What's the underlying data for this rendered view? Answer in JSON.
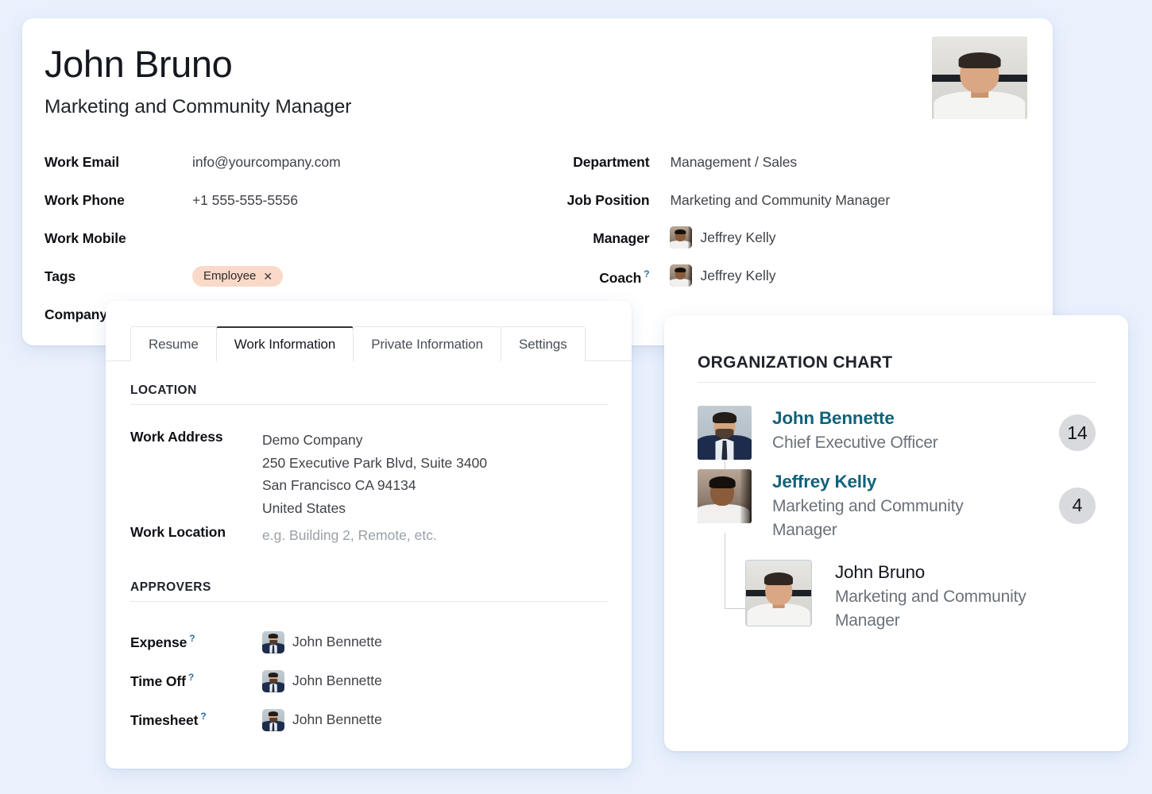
{
  "profile": {
    "name": "John Bruno",
    "job_title": "Marketing and Community Manager",
    "photo_alt": "employee-photo",
    "left_fields": [
      {
        "label": "Work Email",
        "value": "info@yourcompany.com"
      },
      {
        "label": "Work Phone",
        "value": "+1 555-555-5556"
      },
      {
        "label": "Work Mobile",
        "value": ""
      },
      {
        "label": "Tags",
        "value": ""
      },
      {
        "label": "Company",
        "value": ""
      }
    ],
    "tag": {
      "label": "Employee",
      "remove": "✕",
      "bg": "#fad9c8"
    },
    "right_fields": [
      {
        "label": "Department",
        "value": "Management / Sales"
      },
      {
        "label": "Job Position",
        "value": "Marketing and Community Manager"
      }
    ],
    "manager": {
      "label": "Manager",
      "name": "Jeffrey Kelly"
    },
    "coach": {
      "label": "Coach",
      "help": "?",
      "name": "Jeffrey Kelly"
    }
  },
  "work_card": {
    "tabs": [
      {
        "label": "Resume",
        "active": false
      },
      {
        "label": "Work Information",
        "active": true
      },
      {
        "label": "Private Information",
        "active": false
      },
      {
        "label": "Settings",
        "active": false
      }
    ],
    "location": {
      "heading": "LOCATION",
      "work_address_label": "Work Address",
      "work_address_lines": [
        "Demo Company",
        "250 Executive Park Blvd, Suite 3400",
        "San Francisco CA 94134",
        "United States"
      ],
      "work_location_label": "Work Location",
      "work_location_placeholder": "e.g. Building 2, Remote, etc."
    },
    "approvers": {
      "heading": "APPROVERS",
      "rows": [
        {
          "label": "Expense",
          "help": "?",
          "name": "John Bennette"
        },
        {
          "label": "Time Off",
          "help": "?",
          "name": "John Bennette"
        },
        {
          "label": "Timesheet",
          "help": "?",
          "name": "John Bennette"
        }
      ]
    }
  },
  "org_chart": {
    "title": "ORGANIZATION CHART",
    "link_color": "#10627a",
    "badge_bg": "#d9dadd",
    "nodes": [
      {
        "name": "John Bennette",
        "role": "Chief Executive Officer",
        "count": "14",
        "current": false
      },
      {
        "name": "Jeffrey Kelly",
        "role": "Marketing and Community Manager",
        "count": "4",
        "current": false
      },
      {
        "name": "John Bruno",
        "role": "Marketing and Community Manager",
        "count": "",
        "current": true
      }
    ]
  },
  "theme": {
    "page_bg": "#eaf1fd",
    "card_bg": "#ffffff",
    "text_primary": "#16181f",
    "text_muted": "#6b7279",
    "accent_teal": "#10627a",
    "tag_bg": "#fad9c8"
  }
}
